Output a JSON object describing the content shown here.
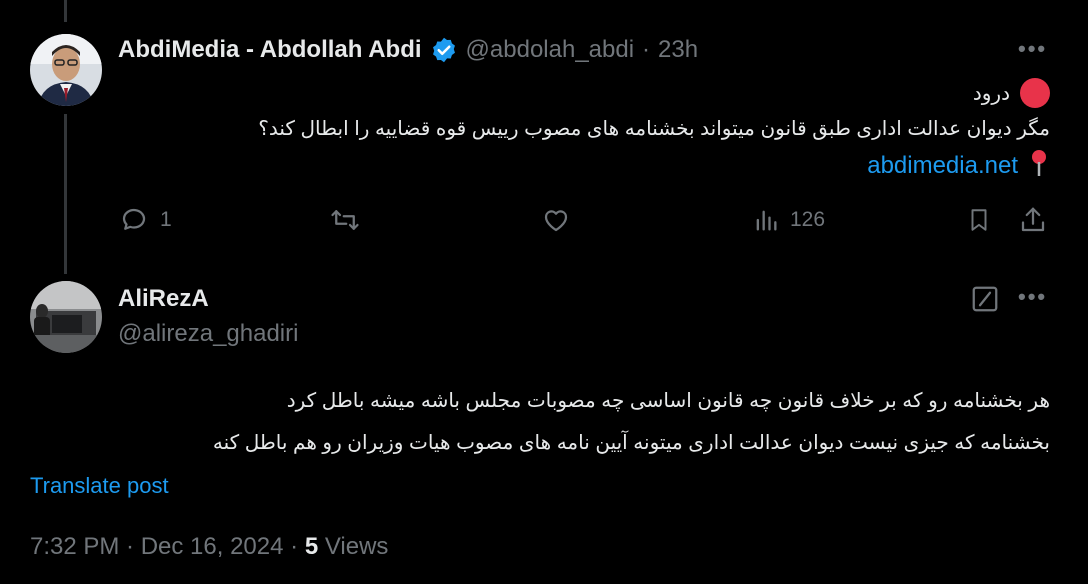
{
  "tweet": {
    "display_name": "AbdiMedia - Abdollah Abdi",
    "handle": "@abdolah_abdi",
    "separator": "·",
    "time": "23h",
    "greeting": "درود",
    "text": "مگر دیوان عدالت اداری طبق قانون میتواند بخشنامه های مصوب رییس قوه قضاییه را ابطال کند؟",
    "link": "abdimedia.net",
    "replies": "1",
    "views": "126"
  },
  "reply": {
    "display_name": "AliRezA",
    "handle": "@alireza_ghadiri",
    "line1": "هر بخشنامه رو که بر خلاف قانون چه قانون اساسی چه مصوبات مجلس باشه میشه باطل کرد",
    "line2": "بخشنامه که جیزی نیست دیوان عدالت اداری میتونه آیین نامه های مصوب هیات وزیران رو  هم باطل کنه",
    "translate": "Translate post",
    "timestamp": "7:32 PM · Dec 16, 2024 · ",
    "views_count": "5",
    "views_label": " Views"
  },
  "icons": {
    "verified": "verified-badge-icon",
    "more": "more-icon",
    "reply": "reply-icon",
    "retweet": "retweet-icon",
    "like": "like-icon",
    "views": "views-icon",
    "bookmark": "bookmark-icon",
    "share": "share-icon",
    "edit": "edit-icon",
    "pin": "pin-icon"
  },
  "colors": {
    "accent": "#1d9bf0",
    "muted": "#71767b",
    "text": "#e7e9ea",
    "background": "#000000"
  }
}
